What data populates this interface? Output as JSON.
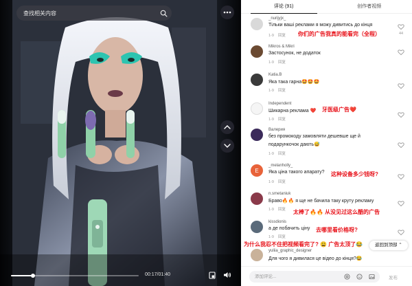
{
  "search": {
    "placeholder": "查找相关内容"
  },
  "player": {
    "time": "00:17/01:40",
    "progress": 0.17
  },
  "tabs": [
    {
      "label": "评论 (91)",
      "active": true
    },
    {
      "label": "创作者视频",
      "active": false
    }
  ],
  "comments": [
    {
      "user": "_nurijyjx_",
      "text": "Тільки ваші реклами я можу дивитись до кінця",
      "date": "1-9",
      "reply": "回复",
      "likes": "44",
      "avatar_color": "#d9d9d9"
    },
    {
      "user": "Mikros & Mikri",
      "text": "Застосунок, не додаток",
      "date": "1-9",
      "reply": "回复",
      "likes": "",
      "avatar_color": "#6b4a32"
    },
    {
      "user": "Katia.B",
      "text": "Яка така гарна🤩🤩🤩",
      "date": "1-9",
      "reply": "回复",
      "likes": "",
      "avatar_color": "#3a3a3a"
    },
    {
      "user": "Independent",
      "text": "Шикарна реклама ❤️",
      "date": "1-9",
      "reply": "回复",
      "likes": "",
      "avatar_color": "#f5f5f5"
    },
    {
      "user": "Валерия",
      "text": "без промокоду замовляти дешевше ще й",
      "text2": "подарункочок дають😅",
      "date": "1-9",
      "reply": "回复",
      "likes": "",
      "avatar_color": "#3b2a5a"
    },
    {
      "user": "_melanholly_",
      "text": "Яка ціна такого апарату?",
      "date": "1-9",
      "reply": "回复",
      "likes": "",
      "avatar_color": "#e8633a",
      "avatar_letter": "E"
    },
    {
      "user": "n.smetaniuk",
      "text": "Браво🔥🔥 я ще не бачила таку круту рекламу",
      "date": "1-9",
      "reply": "回复",
      "likes": "",
      "avatar_color": "#8a3a4a"
    },
    {
      "user": "kissdionis",
      "text": "а де побачить ціну",
      "date": "1-9",
      "reply": "回复",
      "likes": "",
      "avatar_color": "#5a6a7a"
    },
    {
      "user": "yuliia_graphic_designer",
      "text": "Для чого я дивилася це відео до кінця?😂",
      "date": "",
      "reply": "",
      "likes": "",
      "avatar_color": "#c9b29a"
    }
  ],
  "overlays": {
    "o1": "你们的广告我真的能看完（全程）",
    "o2": "牙医级广告❤️",
    "o3": "这种设备多少钱呀?",
    "o4": "太棒了🔥🔥 从没见过这么酷的广告",
    "o5": "去哪里看价格呀?",
    "o6": "为什么我忍不住把视频看完了? 😩 广告太顶了😂"
  },
  "back_to_top": "返回到顶部",
  "comment_input": {
    "placeholder": "添加评论...",
    "send": "发布"
  },
  "colors": {
    "overlay_red": "#e8141c",
    "accent": "#fe2c55"
  }
}
